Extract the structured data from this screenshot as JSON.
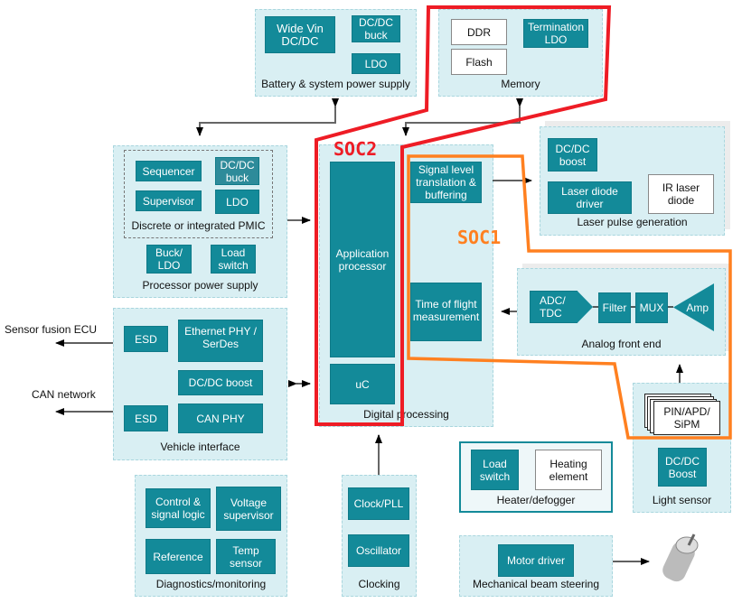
{
  "colors": {
    "block": "#138a99",
    "group": "#d9eff3",
    "soc1": "#ff8020",
    "soc2": "#ee1c25"
  },
  "battery": {
    "label": "Battery & system power supply",
    "wide_vin": "Wide Vin DC/DC",
    "dcdc_buck": "DC/DC buck",
    "ldo": "LDO"
  },
  "memory": {
    "label": "Memory",
    "ddr": "DDR",
    "flash": "Flash",
    "term_ldo": "Termination LDO"
  },
  "proc_power": {
    "label": "Processor power supply",
    "pmic_label": "Discrete or integrated PMIC",
    "sequencer": "Sequencer",
    "dcdc_buck": "DC/DC buck",
    "supervisor": "Supervisor",
    "ldo": "LDO",
    "buck_ldo": "Buck/ LDO",
    "load_switch": "Load switch"
  },
  "digital": {
    "label": "Digital processing",
    "app_proc": "Application processor",
    "uc": "uC",
    "signal_level": "Signal level translation & buffering",
    "tof": "Time of flight measurement"
  },
  "laser": {
    "label": "Laser pulse generation",
    "dcdc_boost": "DC/DC boost",
    "driver": "Laser diode driver",
    "ir_diode": "IR laser diode"
  },
  "afe": {
    "label": "Analog front end",
    "adc": "ADC/ TDC",
    "filter": "Filter",
    "mux": "MUX",
    "amp": "Amp"
  },
  "light": {
    "label": "Light sensor",
    "pin": "PIN/APD/ SiPM",
    "dcdc_boost": "DC/DC Boost"
  },
  "heater": {
    "label": "Heater/defogger",
    "load_switch": "Load switch",
    "heating": "Heating element"
  },
  "mech": {
    "label": "Mechanical beam steering",
    "motor_driver": "Motor driver"
  },
  "vehicle": {
    "label": "Vehicle interface",
    "esd1": "ESD",
    "ethernet": "Ethernet PHY / SerDes",
    "dcdc_boost": "DC/DC boost",
    "esd2": "ESD",
    "can_phy": "CAN PHY"
  },
  "diag": {
    "label": "Diagnostics/monitoring",
    "control": "Control & signal logic",
    "voltage": "Voltage supervisor",
    "reference": "Reference",
    "temp": "Temp sensor"
  },
  "clocking": {
    "label": "Clocking",
    "clock_pll": "Clock/PLL",
    "oscillator": "Oscillator"
  },
  "external": {
    "sensor_fusion": "Sensor fusion ECU",
    "can_network": "CAN network"
  },
  "soc": {
    "soc1": "SOC1",
    "soc2": "SOC2"
  }
}
